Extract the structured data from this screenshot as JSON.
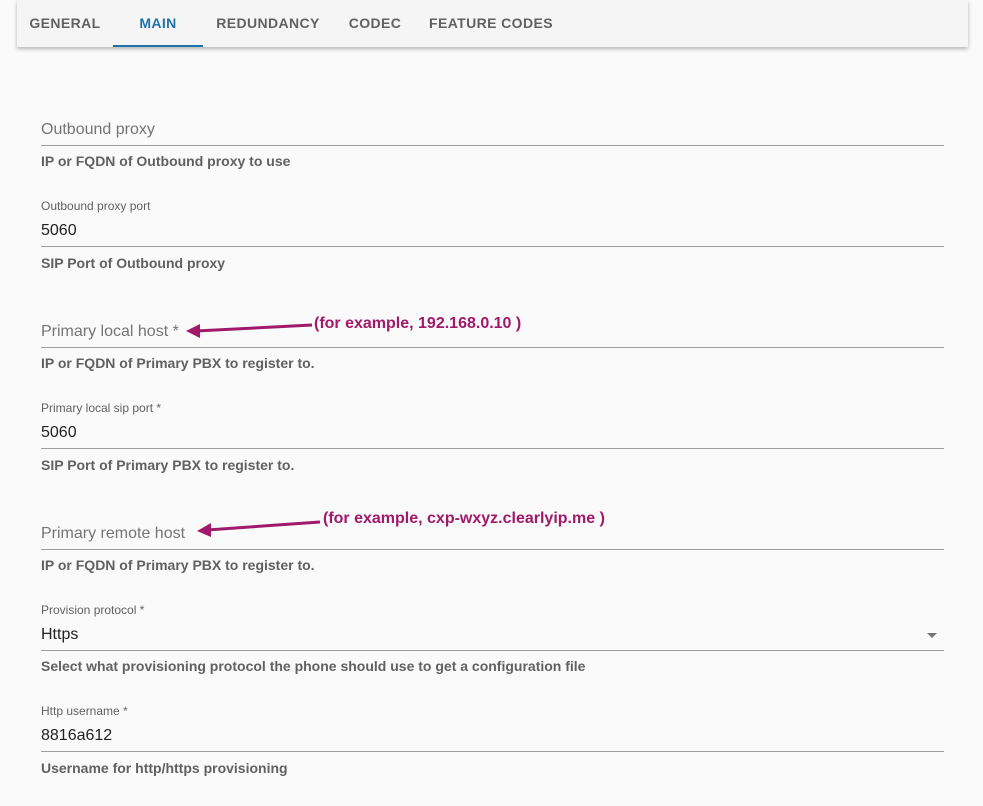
{
  "tabs": [
    {
      "label": "GENERAL",
      "active": false
    },
    {
      "label": "MAIN",
      "active": true
    },
    {
      "label": "REDUNDANCY",
      "active": false
    },
    {
      "label": "CODEC",
      "active": false
    },
    {
      "label": "FEATURE CODES",
      "active": false
    }
  ],
  "fields": {
    "outbound_proxy": {
      "placeholder": "Outbound proxy",
      "value": "",
      "helper": "IP or FQDN of Outbound proxy to use"
    },
    "outbound_proxy_port": {
      "label": "Outbound proxy port",
      "value": "5060",
      "helper": "SIP Port of Outbound proxy"
    },
    "primary_local_host": {
      "placeholder": "Primary local host *",
      "value": "",
      "helper": "IP or FQDN of Primary PBX to register to."
    },
    "primary_local_sip_port": {
      "label": "Primary local sip port *",
      "value": "5060",
      "helper": "SIP Port of Primary PBX to register to."
    },
    "primary_remote_host": {
      "placeholder": "Primary remote host",
      "value": "",
      "helper": "IP or FQDN of Primary PBX to register to."
    },
    "provision_protocol": {
      "label": "Provision protocol *",
      "value": "Https",
      "helper": "Select what provisioning protocol the phone should use to get a configuration file"
    },
    "http_username": {
      "label": "Http username *",
      "value": "8816a612",
      "helper": "Username for http/https provisioning"
    }
  },
  "annotations": {
    "local_host_example": "(for example, 192.168.0.10 )",
    "remote_host_example": "(for example, cxp-wxyz.clearlyip.me )",
    "color": "#a0196b"
  },
  "colors": {
    "accent": "#1e73a8",
    "background": "#fafafa"
  }
}
